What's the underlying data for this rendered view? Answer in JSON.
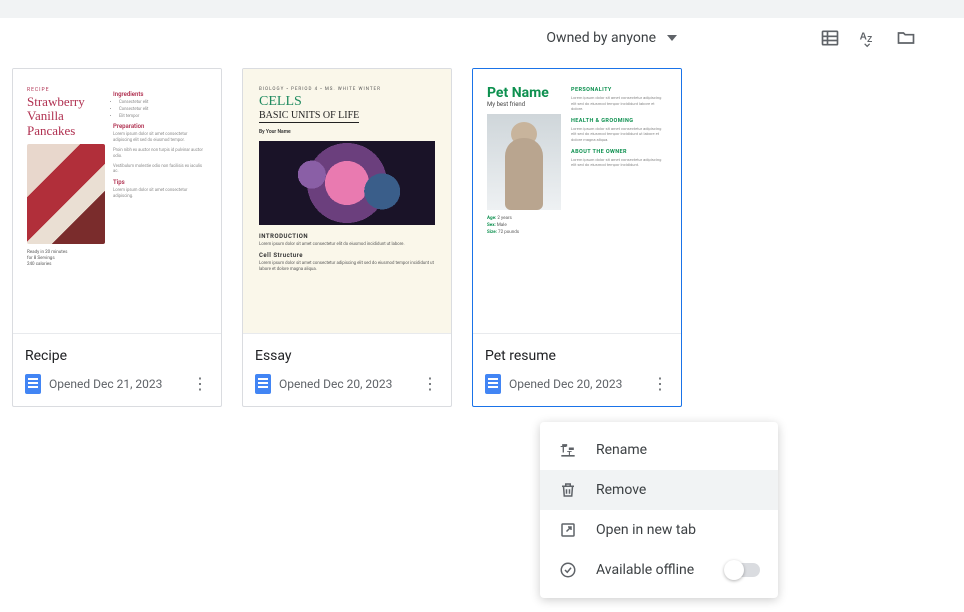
{
  "toolbar": {
    "owner_filter": "Owned by anyone"
  },
  "documents": [
    {
      "title": "Recipe",
      "opened": "Opened Dec 21, 2023",
      "thumb": {
        "category": "RECIPE",
        "headline": "Strawberry Vanilla Pancakes",
        "section_ingredients": "Ingredients",
        "section_preparation": "Preparation",
        "section_tips": "Tips"
      }
    },
    {
      "title": "Essay",
      "opened": "Opened Dec 20, 2023",
      "thumb": {
        "meta": "BIOLOGY • PERIOD 4 • MS. WHITE WINTER",
        "headline": "CELLS",
        "subhead": "BASIC UNITS OF LIFE",
        "byline": "By Your Name",
        "h1": "INTRODUCTION",
        "h2": "Cell Structure"
      }
    },
    {
      "title": "Pet resume",
      "opened": "Opened Dec 20, 2023",
      "thumb": {
        "headline": "Pet Name",
        "subhead": "My best friend",
        "fact_age": "Age:",
        "fact_sex": "Sex:",
        "fact_size": "Size:",
        "h_personality": "PERSONALITY",
        "h_health": "HEALTH & GROOMING",
        "h_owner": "ABOUT THE OWNER"
      }
    }
  ],
  "menu": {
    "rename": "Rename",
    "remove": "Remove",
    "open_new_tab": "Open in new tab",
    "available_offline": "Available offline"
  }
}
